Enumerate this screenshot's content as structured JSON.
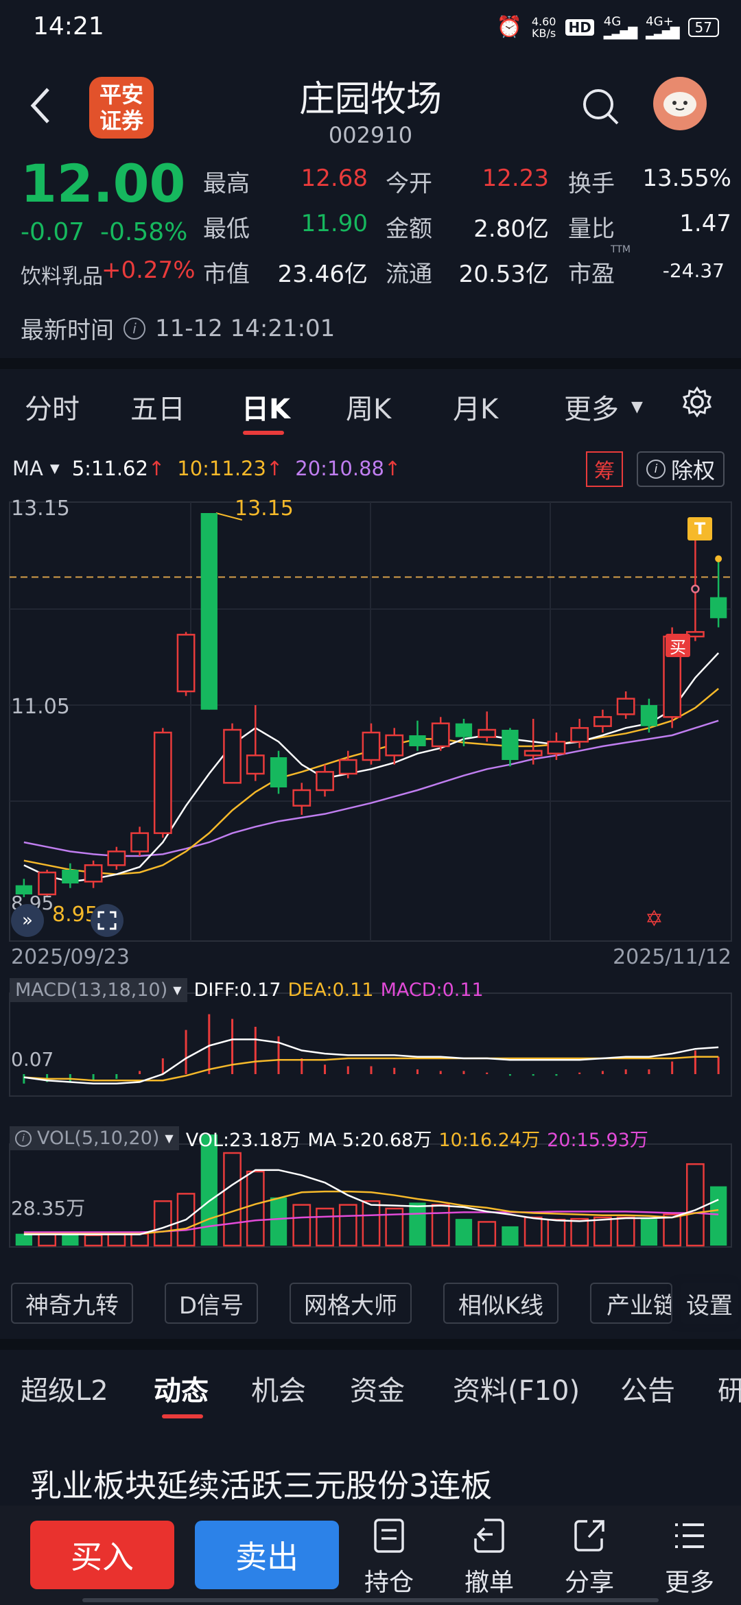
{
  "status": {
    "time": "14:21",
    "net_speed": "4.60",
    "net_unit": "KB/s",
    "hd": "HD",
    "sig1": "4G",
    "sig2": "4G+",
    "battery": "57"
  },
  "header": {
    "logo_line1": "平安",
    "logo_line2": "证券",
    "title": "庄园牧场",
    "code": "002910"
  },
  "quote": {
    "price": "12.00",
    "change": "-0.07",
    "change_pct": "-0.58%",
    "sector": "饮料乳品",
    "sector_pct": "+0.27%",
    "high_label": "最高",
    "high": "12.68",
    "open_label": "今开",
    "open": "12.23",
    "turnover_label": "换手",
    "turnover": "13.55%",
    "low_label": "最低",
    "low": "11.90",
    "amount_label": "金额",
    "amount": "2.80亿",
    "vol_ratio_label": "量比",
    "vol_ratio": "1.47",
    "mcap_label": "市值",
    "mcap": "23.46亿",
    "float_label": "流通",
    "float": "20.53亿",
    "pe_label": "市盈",
    "pe_sup": "TTM",
    "pe": "-24.37",
    "time_label": "最新时间",
    "time": "11-12 14:21:01"
  },
  "tabs": {
    "t1": "分时",
    "t2": "五日",
    "t3": "日K",
    "t4": "周K",
    "t5": "月K",
    "more": "更多"
  },
  "ma_bar": {
    "label": "MA",
    "ma5": "5:11.62",
    "ma10": "10:11.23",
    "ma20": "20:10.88",
    "chip": "筹",
    "adjust": "除权"
  },
  "kline": {
    "price_high": "13.15",
    "price_mid": "11.05",
    "price_low": "8.95",
    "max_label": "13.15",
    "min_label": "8.95",
    "date_start": "2025/09/23",
    "date_end": "2025/11/12",
    "buy_mark": "买",
    "t_mark": "T",
    "macd_title": "MACD(13,18,10)",
    "diff": "DIFF:0.17",
    "dea": "DEA:0.11",
    "macd": "MACD:0.11",
    "macd_axis": "0.07",
    "vol_title": "VOL(5,10,20)",
    "vol": "VOL:23.18万",
    "vol_ma5": "MA 5:20.68万",
    "vol_ma10": "10:16.24万",
    "vol_ma20": "20:15.93万",
    "vol_axis": "28.35万"
  },
  "tools": {
    "c1": "神奇九转",
    "c2": "D信号",
    "c3": "网格大师",
    "c4": "相似K线",
    "c5": "产业链",
    "settings": "设置"
  },
  "subtabs": {
    "s1": "超级L2",
    "s2": "动态",
    "s3": "机会",
    "s4": "资金",
    "s5": "资料(F10)",
    "s6": "公告",
    "s7": "研"
  },
  "news": {
    "headline": "乳业板块延续活跃三元股份3连板"
  },
  "bottom": {
    "buy": "买入",
    "sell": "卖出",
    "hold": "持仓",
    "cancel": "撤单",
    "share": "分享",
    "more": "更多"
  },
  "colors": {
    "up": "#e93b3b",
    "down": "#16b85e",
    "ma5": "#ffffff",
    "ma10": "#f6b92a",
    "ma20": "#c07ef0",
    "accent": "#e93b3b"
  },
  "chart_data": {
    "type": "candlestick",
    "x_start": "2025/09/23",
    "x_end": "2025/11/12",
    "ylim": [
      8.95,
      13.15
    ],
    "candles": [
      {
        "o": 9.08,
        "h": 9.15,
        "l": 8.95,
        "c": 8.98
      },
      {
        "o": 8.98,
        "h": 9.25,
        "l": 8.95,
        "c": 9.22
      },
      {
        "o": 9.25,
        "h": 9.32,
        "l": 9.05,
        "c": 9.1
      },
      {
        "o": 9.12,
        "h": 9.35,
        "l": 9.05,
        "c": 9.3
      },
      {
        "o": 9.3,
        "h": 9.5,
        "l": 9.25,
        "c": 9.45
      },
      {
        "o": 9.45,
        "h": 9.72,
        "l": 9.4,
        "c": 9.65
      },
      {
        "o": 9.65,
        "h": 10.8,
        "l": 9.6,
        "c": 10.75
      },
      {
        "o": 11.2,
        "h": 11.85,
        "l": 11.15,
        "c": 11.82
      },
      {
        "o": 13.15,
        "h": 13.15,
        "l": 11.0,
        "c": 11.0
      },
      {
        "o": 10.2,
        "h": 10.85,
        "l": 10.2,
        "c": 10.78
      },
      {
        "o": 10.3,
        "h": 11.05,
        "l": 10.22,
        "c": 10.5
      },
      {
        "o": 10.48,
        "h": 10.55,
        "l": 10.08,
        "c": 10.15
      },
      {
        "o": 9.95,
        "h": 10.2,
        "l": 9.85,
        "c": 10.12
      },
      {
        "o": 10.12,
        "h": 10.4,
        "l": 10.05,
        "c": 10.32
      },
      {
        "o": 10.3,
        "h": 10.55,
        "l": 10.25,
        "c": 10.45
      },
      {
        "o": 10.45,
        "h": 10.85,
        "l": 10.4,
        "c": 10.75
      },
      {
        "o": 10.5,
        "h": 10.8,
        "l": 10.4,
        "c": 10.72
      },
      {
        "o": 10.72,
        "h": 10.88,
        "l": 10.55,
        "c": 10.6
      },
      {
        "o": 10.6,
        "h": 10.92,
        "l": 10.55,
        "c": 10.85
      },
      {
        "o": 10.85,
        "h": 10.9,
        "l": 10.6,
        "c": 10.7
      },
      {
        "o": 10.7,
        "h": 10.98,
        "l": 10.65,
        "c": 10.78
      },
      {
        "o": 10.78,
        "h": 10.8,
        "l": 10.38,
        "c": 10.45
      },
      {
        "o": 10.5,
        "h": 10.9,
        "l": 10.4,
        "c": 10.55
      },
      {
        "o": 10.52,
        "h": 10.75,
        "l": 10.45,
        "c": 10.65
      },
      {
        "o": 10.65,
        "h": 10.9,
        "l": 10.58,
        "c": 10.8
      },
      {
        "o": 10.82,
        "h": 11.0,
        "l": 10.75,
        "c": 10.92
      },
      {
        "o": 10.95,
        "h": 11.2,
        "l": 10.9,
        "c": 11.12
      },
      {
        "o": 11.05,
        "h": 11.12,
        "l": 10.75,
        "c": 10.82
      },
      {
        "o": 10.92,
        "h": 11.9,
        "l": 10.8,
        "c": 11.8
      },
      {
        "o": 11.8,
        "h": 12.85,
        "l": 11.75,
        "c": 11.85
      },
      {
        "o": 12.23,
        "h": 12.68,
        "l": 11.9,
        "c": 12.0
      }
    ],
    "ma5": [
      9.3,
      9.18,
      9.12,
      9.15,
      9.2,
      9.28,
      9.55,
      9.95,
      10.3,
      10.62,
      10.8,
      10.65,
      10.4,
      10.25,
      10.3,
      10.35,
      10.42,
      10.52,
      10.58,
      10.68,
      10.72,
      10.68,
      10.65,
      10.62,
      10.65,
      10.72,
      10.8,
      10.85,
      11.0,
      11.35,
      11.62
    ],
    "ma10": [
      9.35,
      9.3,
      9.25,
      9.22,
      9.2,
      9.22,
      9.3,
      9.45,
      9.65,
      9.9,
      10.1,
      10.25,
      10.32,
      10.4,
      10.48,
      10.55,
      10.62,
      10.68,
      10.68,
      10.64,
      10.62,
      10.6,
      10.6,
      10.62,
      10.66,
      10.7,
      10.74,
      10.8,
      10.88,
      11.02,
      11.23
    ],
    "ma20": [
      9.55,
      9.5,
      9.45,
      9.42,
      9.4,
      9.4,
      9.42,
      9.48,
      9.55,
      9.65,
      9.72,
      9.78,
      9.82,
      9.86,
      9.92,
      9.98,
      10.05,
      10.12,
      10.2,
      10.28,
      10.35,
      10.4,
      10.46,
      10.5,
      10.55,
      10.6,
      10.64,
      10.68,
      10.72,
      10.8,
      10.88
    ],
    "macd_hist": [
      -0.06,
      -0.05,
      -0.05,
      -0.04,
      -0.03,
      0.02,
      0.1,
      0.28,
      0.38,
      0.35,
      0.3,
      0.24,
      0.1,
      0.06,
      0.05,
      0.05,
      0.04,
      0.03,
      0.02,
      0.02,
      0.01,
      -0.01,
      -0.01,
      -0.01,
      0.01,
      0.02,
      0.03,
      0.03,
      0.08,
      0.15,
      0.11
    ],
    "diff": [
      -0.02,
      -0.04,
      -0.05,
      -0.06,
      -0.06,
      -0.05,
      0.0,
      0.1,
      0.18,
      0.22,
      0.22,
      0.2,
      0.15,
      0.13,
      0.12,
      0.12,
      0.12,
      0.11,
      0.11,
      0.1,
      0.1,
      0.09,
      0.09,
      0.09,
      0.09,
      0.1,
      0.11,
      0.11,
      0.13,
      0.16,
      0.17
    ],
    "dea": [
      -0.02,
      -0.03,
      -0.03,
      -0.04,
      -0.04,
      -0.04,
      -0.04,
      -0.01,
      0.03,
      0.06,
      0.08,
      0.09,
      0.09,
      0.09,
      0.1,
      0.1,
      0.1,
      0.1,
      0.1,
      0.1,
      0.1,
      0.1,
      0.1,
      0.1,
      0.1,
      0.1,
      0.1,
      0.1,
      0.1,
      0.11,
      0.11
    ],
    "volume": [
      1.6,
      1.5,
      1.4,
      1.4,
      1.5,
      1.6,
      6.0,
      7.0,
      15.0,
      12.5,
      10.0,
      6.5,
      5.5,
      5.0,
      5.5,
      6.0,
      5.0,
      5.8,
      5.5,
      3.6,
      3.2,
      2.6,
      3.8,
      3.5,
      3.6,
      3.8,
      3.8,
      3.6,
      4.2,
      11.0,
      8.0
    ],
    "vol_ma5": [
      1.5,
      1.5,
      1.5,
      1.5,
      1.5,
      1.5,
      2.4,
      3.5,
      6.0,
      8.2,
      10.2,
      10.2,
      9.5,
      8.5,
      6.8,
      5.5,
      5.4,
      5.3,
      5.4,
      5.2,
      4.6,
      4.2,
      3.7,
      3.4,
      3.3,
      3.5,
      3.7,
      3.7,
      3.8,
      4.8,
      6.2
    ],
    "vol_ma10": [
      1.6,
      1.6,
      1.6,
      1.6,
      1.6,
      1.6,
      1.9,
      2.3,
      3.6,
      4.6,
      5.6,
      6.4,
      7.2,
      7.3,
      7.3,
      7.2,
      6.8,
      6.3,
      5.9,
      5.4,
      5.1,
      4.6,
      4.4,
      4.3,
      4.2,
      4.1,
      4.1,
      4.0,
      3.8,
      4.4,
      4.8
    ],
    "vol_ma20": [
      1.8,
      1.8,
      1.8,
      1.8,
      1.8,
      1.8,
      1.9,
      2.1,
      2.6,
      3.0,
      3.4,
      3.6,
      3.8,
      3.9,
      4.0,
      4.1,
      4.2,
      4.3,
      4.4,
      4.5,
      4.5,
      4.5,
      4.5,
      4.6,
      4.6,
      4.6,
      4.6,
      4.5,
      4.4,
      4.4,
      4.2
    ]
  }
}
